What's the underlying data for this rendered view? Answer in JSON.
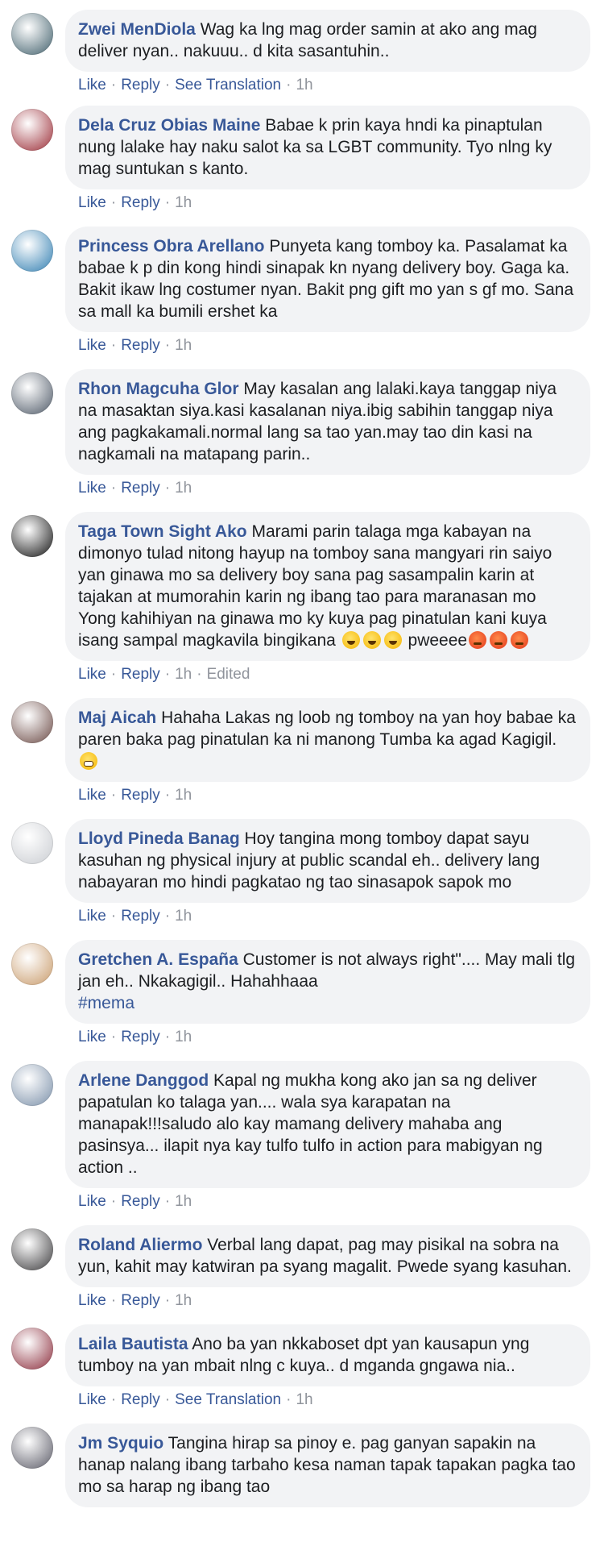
{
  "labels": {
    "like": "Like",
    "reply": "Reply",
    "see_translation": "See Translation",
    "edited": "Edited"
  },
  "comments": [
    {
      "author": "Zwei MenDiola",
      "text": "Wag ka lng mag order samin at ako ang mag deliver nyan.. nakuuu.. d kita sasantuhin..",
      "time": "1h",
      "translation": true,
      "avatar": "#3f5e6a"
    },
    {
      "author": "Dela Cruz Obias Maine",
      "text": "Babae k prin kaya hndi ka pinaptulan nung lalake hay naku salot ka sa LGBT community. Tyo nlng ky mag suntukan s kanto.",
      "time": "1h",
      "avatar": "#9a2b35"
    },
    {
      "author": "Princess Obra Arellano",
      "text": "Punyeta kang tomboy ka. Pasalamat ka babae k p din kong hindi sinapak kn nyang delivery boy. Gaga ka. Bakit ikaw lng costumer nyan. Bakit png gift mo yan s gf mo. Sana sa mall ka bumili ershet ka",
      "time": "1h",
      "avatar": "#2f7db0"
    },
    {
      "author": "Rhon Magcuha Glor",
      "text": "May kasalan ang lalaki.kaya tanggap niya na masaktan siya.kasi kasalanan niya.ibig sabihin tanggap niya ang pagkakamali.normal lang sa tao yan.may tao din kasi na nagkamali na matapang parin..",
      "time": "1h",
      "avatar": "#4d5866"
    },
    {
      "author": "Taga Town Sight Ako",
      "text": "Marami parin talaga mga kabayan na dimonyo tulad nitong hayup na tomboy sana mangyari rin saiyo yan ginawa mo sa delivery boy sana pag sasampalin karin at tajakan at mumorahin karin ng ibang tao para maranasan mo Yong kahihiyan na ginawa mo ky kuya pag pinatulan kani kuya isang sampal magkavila bingikana",
      "emoji_a": "laugh",
      "tail": " pweeee",
      "emoji_b": "angry",
      "time": "1h",
      "edited": true,
      "avatar": "#111111"
    },
    {
      "author": "Maj Aicah",
      "text": "Hahaha Lakas ng loob ng tomboy na yan hoy babae ka paren baka pag pinatulan ka ni manong Tumba ka agad Kagigil.",
      "emoji_end": "fear",
      "time": "1h",
      "avatar": "#6b4a45"
    },
    {
      "author": "Lloyd Pineda Banag",
      "text": "Hoy tangina mong tomboy dapat sayu kasuhan ng physical injury at public scandal eh.. delivery lang nabayaran mo hindi pagkatao ng tao sinasapok sapok mo",
      "time": "1h",
      "avatar": "#c9ccd1"
    },
    {
      "author": "Gretchen A. España",
      "text": "Customer is not always right\".... May mali tlg jan eh.. Nkakagigil.. Hahahhaaa",
      "hashtag": "#mema",
      "time": "1h",
      "avatar": "#c89a6a"
    },
    {
      "author": "Arlene Danggod",
      "text": "Kapal ng mukha kong ako jan sa ng deliver papatulan ko talaga yan.... wala sya karapatan na manapak!!!saludo alo kay mamang delivery mahaba ang pasinsya... ilapit nya kay tulfo tulfo in action para mabigyan ng action ..",
      "time": "1h",
      "avatar": "#7a8fa8"
    },
    {
      "author": "Roland Aliermo",
      "text": "Verbal lang dapat, pag may pisikal na sobra na yun, kahit may katwiran pa syang magalit. Pwede syang kasuhan.",
      "time": "1h",
      "avatar": "#3b3a3c"
    },
    {
      "author": "Laila Bautista",
      "text": "Ano ba yan nkkaboset dpt yan kausapun yng tumboy na yan mbait nlng c kuya.. d mganda gngawa nia..",
      "time": "1h",
      "translation": true,
      "avatar": "#8b2c3b"
    },
    {
      "author": "Jm Syquio",
      "text": "Tangina hirap sa pinoy e. pag ganyan sapakin na hanap nalang ibang tarbaho kesa naman tapak tapakan pagka tao mo sa harap ng ibang tao",
      "time": "",
      "avatar": "#5a5a66"
    }
  ]
}
